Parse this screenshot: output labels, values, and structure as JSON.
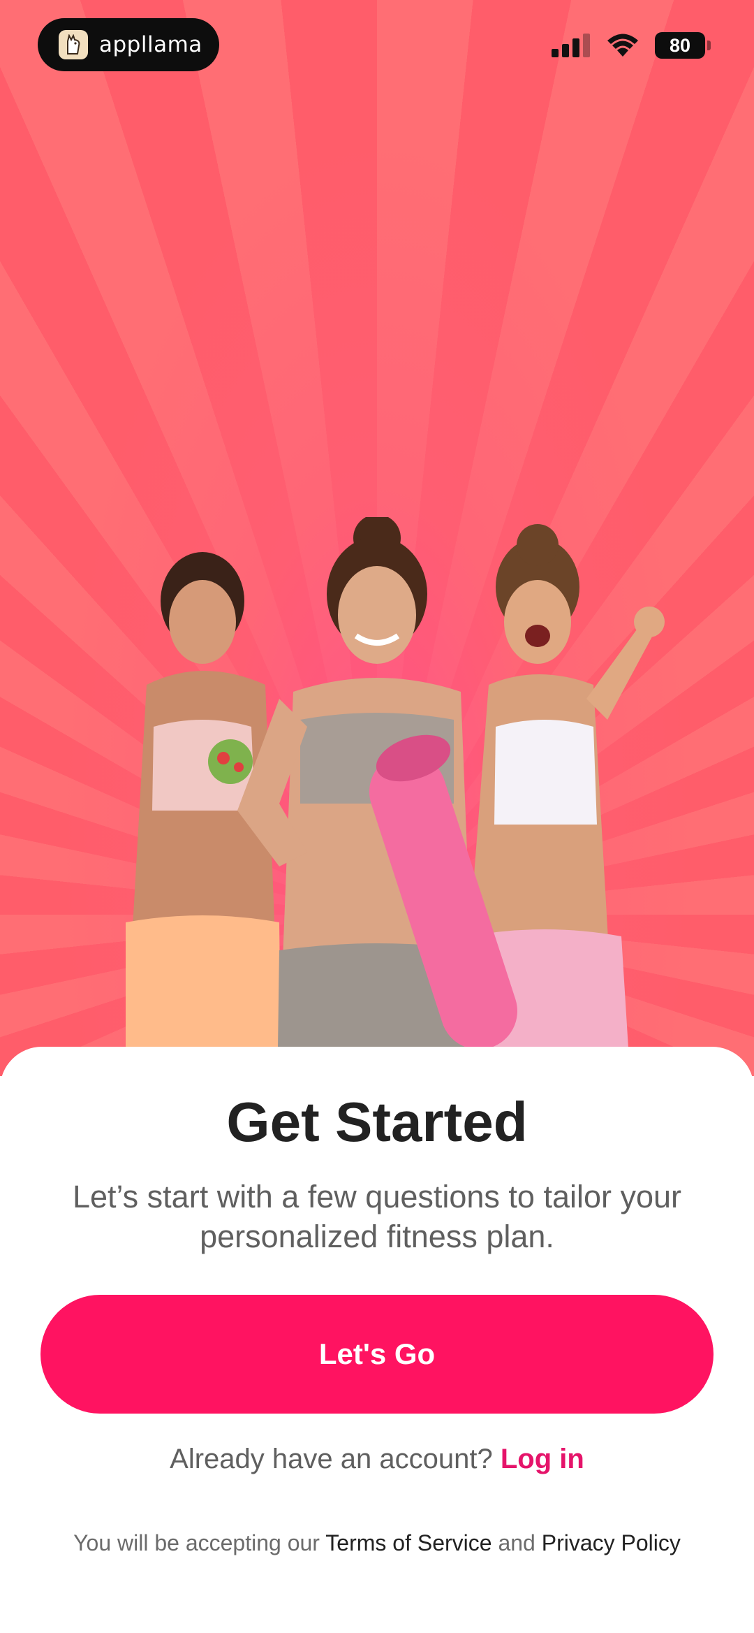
{
  "status_bar": {
    "brand_name": "appllama",
    "battery_level": "80",
    "icons": [
      "cellular-signal-icon",
      "wifi-icon",
      "battery-icon"
    ]
  },
  "hero": {
    "image": "three smiling women in fitness wear, center woman holding a pink yoga mat"
  },
  "onboarding": {
    "title": "Get Started",
    "subtitle": "Let’s start with a few questions to tailor your personalized fitness plan.",
    "cta_label": "Let's Go",
    "login_prompt": "Already have an account?",
    "login_link": "Log in",
    "legal_prefix": "You will be accepting our",
    "terms_link": "Terms of Service",
    "legal_and": "and",
    "privacy_link": "Privacy Policy"
  },
  "colors": {
    "accent": "#ff1361",
    "link": "#e5146a",
    "hero_background": "#ff6a72",
    "title_text": "#222222",
    "body_text": "#5f5f5f"
  }
}
